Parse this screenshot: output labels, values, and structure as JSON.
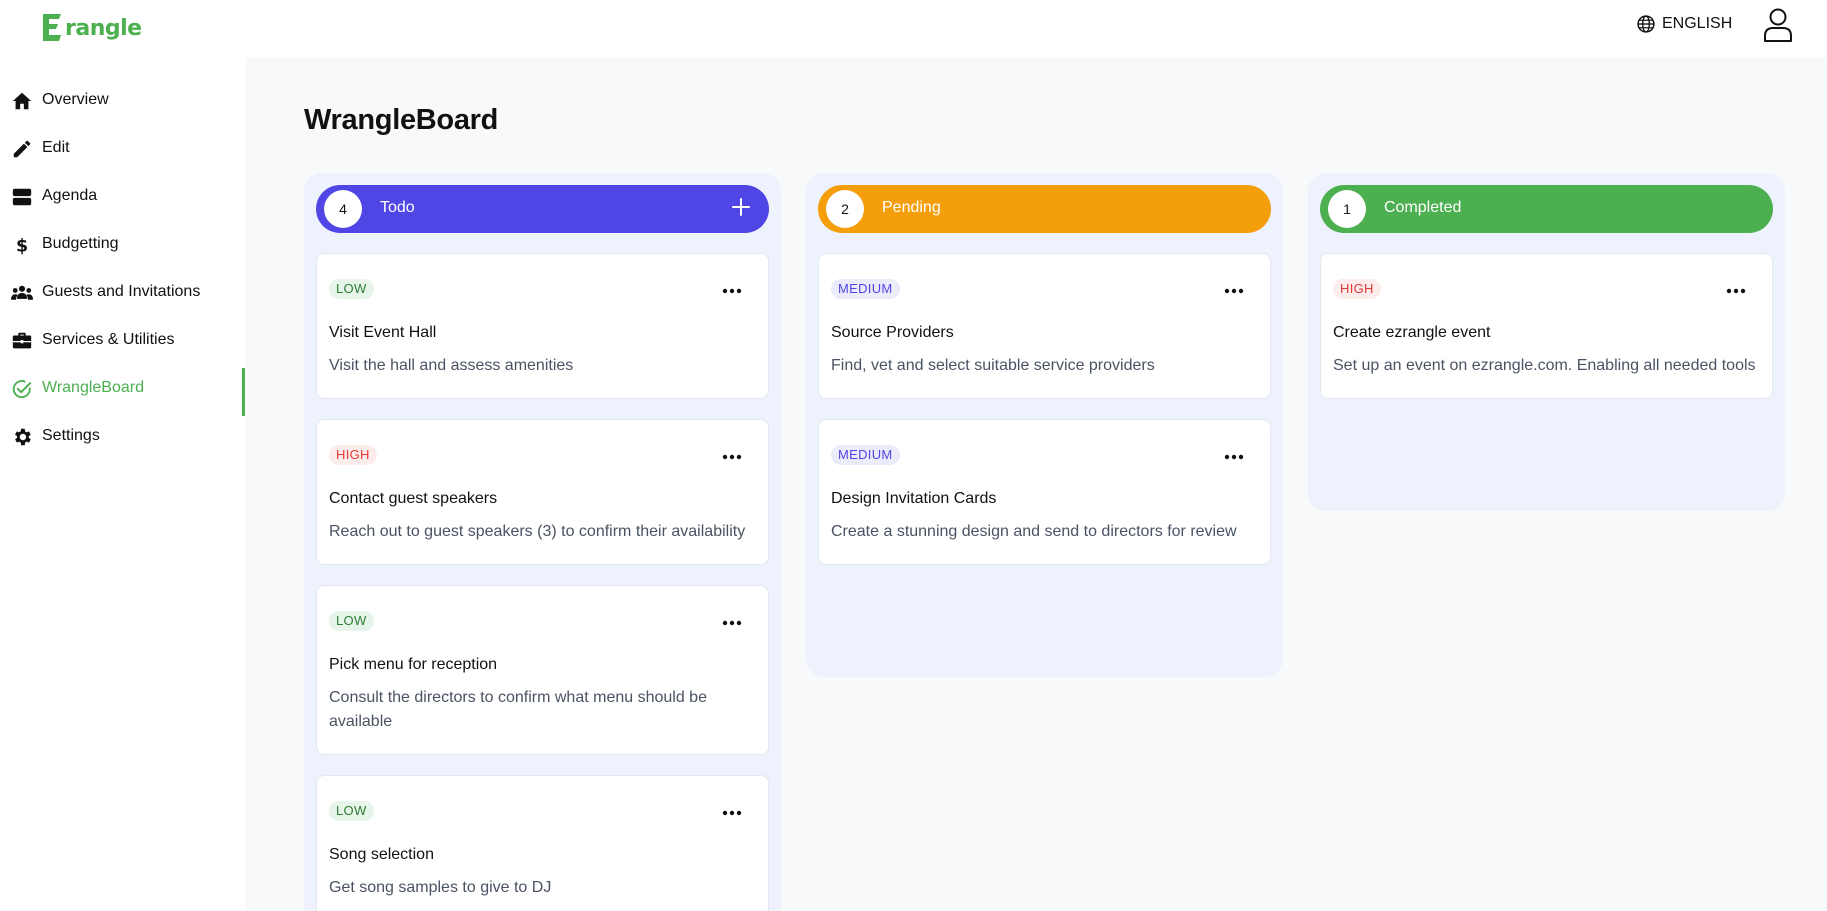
{
  "brand": {
    "logo_text": "rangle",
    "logo_text_full": "Ezrangle"
  },
  "header": {
    "language": "ENGLISH"
  },
  "sidebar": {
    "items": [
      {
        "label": "Overview",
        "icon": "home-icon"
      },
      {
        "label": "Edit",
        "icon": "pencil-icon"
      },
      {
        "label": "Agenda",
        "icon": "agenda-icon"
      },
      {
        "label": "Budgetting",
        "icon": "dollar-icon"
      },
      {
        "label": "Guests and Invitations",
        "icon": "people-icon"
      },
      {
        "label": "Services & Utilities",
        "icon": "briefcase-icon"
      },
      {
        "label": "WrangleBoard",
        "icon": "task-check-icon",
        "active": true
      },
      {
        "label": "Settings",
        "icon": "gear-icon"
      }
    ]
  },
  "page": {
    "title": "WrangleBoard"
  },
  "colors": {
    "accent": "#4caf50",
    "todo": "#4f46e5",
    "pending": "#f59e0b",
    "completed": "#4caf50"
  },
  "board": {
    "columns": [
      {
        "name": "Todo",
        "count": "4",
        "cards": [
          {
            "priority": "LOW",
            "title": "Visit Event Hall",
            "description": "Visit the hall and assess amenities"
          },
          {
            "priority": "HIGH",
            "title": "Contact guest speakers",
            "description": "Reach out to guest speakers (3) to confirm their availability"
          },
          {
            "priority": "LOW",
            "title": "Pick menu for reception",
            "description": "Consult the directors to confirm what menu should be available"
          },
          {
            "priority": "LOW",
            "title": "Song selection",
            "description": "Get song samples to give to DJ"
          }
        ]
      },
      {
        "name": "Pending",
        "count": "2",
        "cards": [
          {
            "priority": "MEDIUM",
            "title": "Source Providers",
            "description": "Find, vet and select suitable service providers"
          },
          {
            "priority": "MEDIUM",
            "title": "Design Invitation Cards",
            "description": "Create a stunning design and send to directors for review"
          }
        ]
      },
      {
        "name": "Completed",
        "count": "1",
        "cards": [
          {
            "priority": "HIGH",
            "title": "Create ezrangle event",
            "description": "Set up an event on ezrangle.com. Enabling all needed tools"
          }
        ]
      }
    ]
  }
}
